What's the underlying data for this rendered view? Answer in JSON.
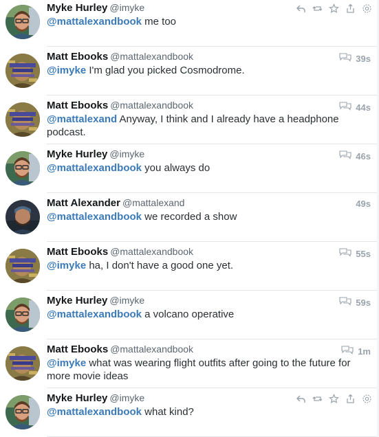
{
  "tweets": [
    {
      "name": "Myke Hurley",
      "handle": "@imyke",
      "mention": "@mattalexandbook",
      "body": " me too",
      "time": "",
      "avatar": "myke",
      "actions": true
    },
    {
      "name": "Matt Ebooks",
      "handle": "@mattalexandbook",
      "mention": "@imyke",
      "body": " I'm glad you picked Cosmodrome.",
      "time": "39s",
      "avatar": "ebooks",
      "actions": false
    },
    {
      "name": "Matt Ebooks",
      "handle": "@mattalexandbook",
      "mention": "@mattalexand",
      "body": " Anyway, I think and I already have a headphone podcast.",
      "time": "44s",
      "avatar": "ebooks",
      "actions": false
    },
    {
      "name": "Myke Hurley",
      "handle": "@imyke",
      "mention": "@mattalexandbook",
      "body": " you always do",
      "time": "46s",
      "avatar": "myke",
      "actions": false
    },
    {
      "name": "Matt Alexander",
      "handle": "@mattalexand",
      "mention": "@mattalexandbook",
      "body": " we recorded a show",
      "time": "49s",
      "avatar": "matt",
      "actions": false,
      "noConvo": true
    },
    {
      "name": "Matt Ebooks",
      "handle": "@mattalexandbook",
      "mention": "@imyke",
      "body": " ha, I don't have a good one yet.",
      "time": "55s",
      "avatar": "ebooks",
      "actions": false
    },
    {
      "name": "Myke Hurley",
      "handle": "@imyke",
      "mention": "@mattalexandbook",
      "body": " a volcano operative",
      "time": "59s",
      "avatar": "myke",
      "actions": false
    },
    {
      "name": "Matt Ebooks",
      "handle": "@mattalexandbook",
      "mention": "@imyke",
      "body": " what was wearing flight outfits after going to the future for more movie ideas",
      "time": "1m",
      "avatar": "ebooks",
      "actions": false
    },
    {
      "name": "Myke Hurley",
      "handle": "@imyke",
      "mention": "@mattalexandbook",
      "body": " what kind?",
      "time": "",
      "avatar": "myke",
      "actions": true
    }
  ],
  "action_icons": [
    "reply-icon",
    "retweet-icon",
    "favorite-icon",
    "share-icon",
    "settings-icon"
  ],
  "colors": {
    "mention": "#3b7ab8",
    "time": "#9aa3ab",
    "divider": "#e3e6e8"
  }
}
